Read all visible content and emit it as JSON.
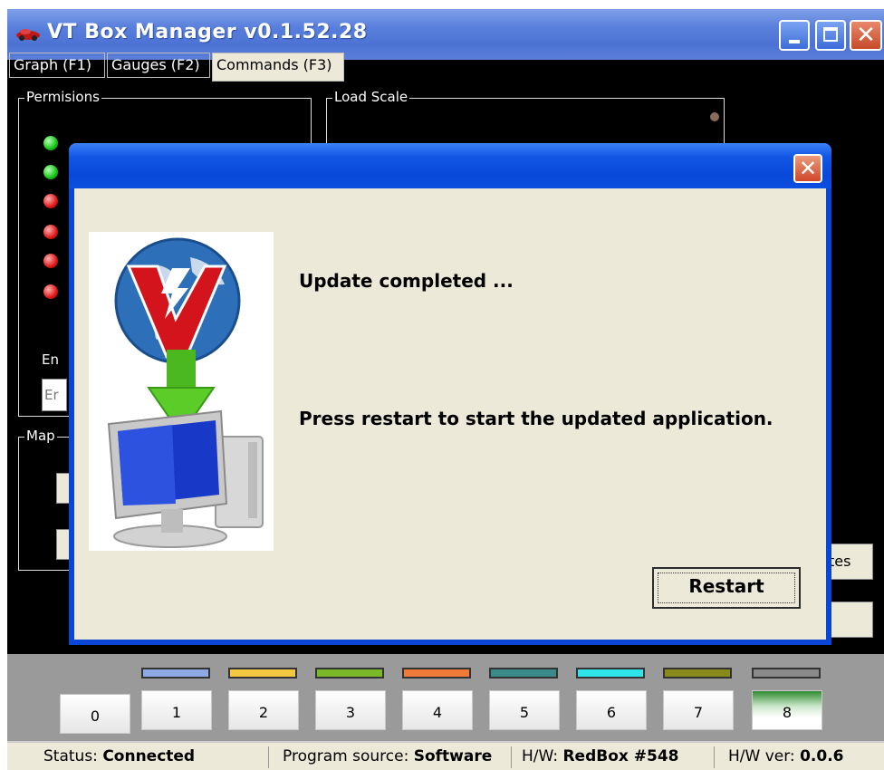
{
  "window": {
    "title": "VT Box Manager v0.1.52.28"
  },
  "tabs": [
    {
      "label": "Graph (F1)"
    },
    {
      "label": "Gauges (F2)"
    },
    {
      "label": "Commands (F3)"
    }
  ],
  "background": {
    "permissions_label": "Permisions",
    "load_scale_label": "Load Scale",
    "map_label": "Map",
    "enter_label_fragment": "En",
    "enter_input_fragment": "Er",
    "right_button_fragment": "tes"
  },
  "dialog": {
    "message_line1": "Update completed ...",
    "message_line2": "Press restart to start the updated application.",
    "restart_label": "Restart",
    "image_icons": [
      "vt-logo-globe-icon",
      "download-arrow-icon",
      "computer-monitor-icon"
    ]
  },
  "channels": [
    {
      "label": "0",
      "color": "#8fa8e6"
    },
    {
      "label": "1",
      "color": "#8fa8e6"
    },
    {
      "label": "2",
      "color": "#f5c842"
    },
    {
      "label": "3",
      "color": "#7ab82a"
    },
    {
      "label": "4",
      "color": "#f07a3a"
    },
    {
      "label": "5",
      "color": "#3a8a8a"
    },
    {
      "label": "6",
      "color": "#2fe3ea"
    },
    {
      "label": "7",
      "color": "#8a8a1a"
    },
    {
      "label": "8",
      "color": "#8a8a8a"
    }
  ],
  "status_bar": {
    "status_label": "Status:",
    "status_value": "Connected",
    "source_label": "Program source:",
    "source_value": "Software",
    "hw_label": "H/W:",
    "hw_value": "RedBox #548",
    "hwver_label": "H/W ver:",
    "hwver_value": "0.0.6"
  },
  "colors": {
    "titlebar_blue": "#4c72d4",
    "dialog_blue": "#0a46d6",
    "dialog_face": "#ece9d8",
    "close_red": "#d0482a"
  }
}
